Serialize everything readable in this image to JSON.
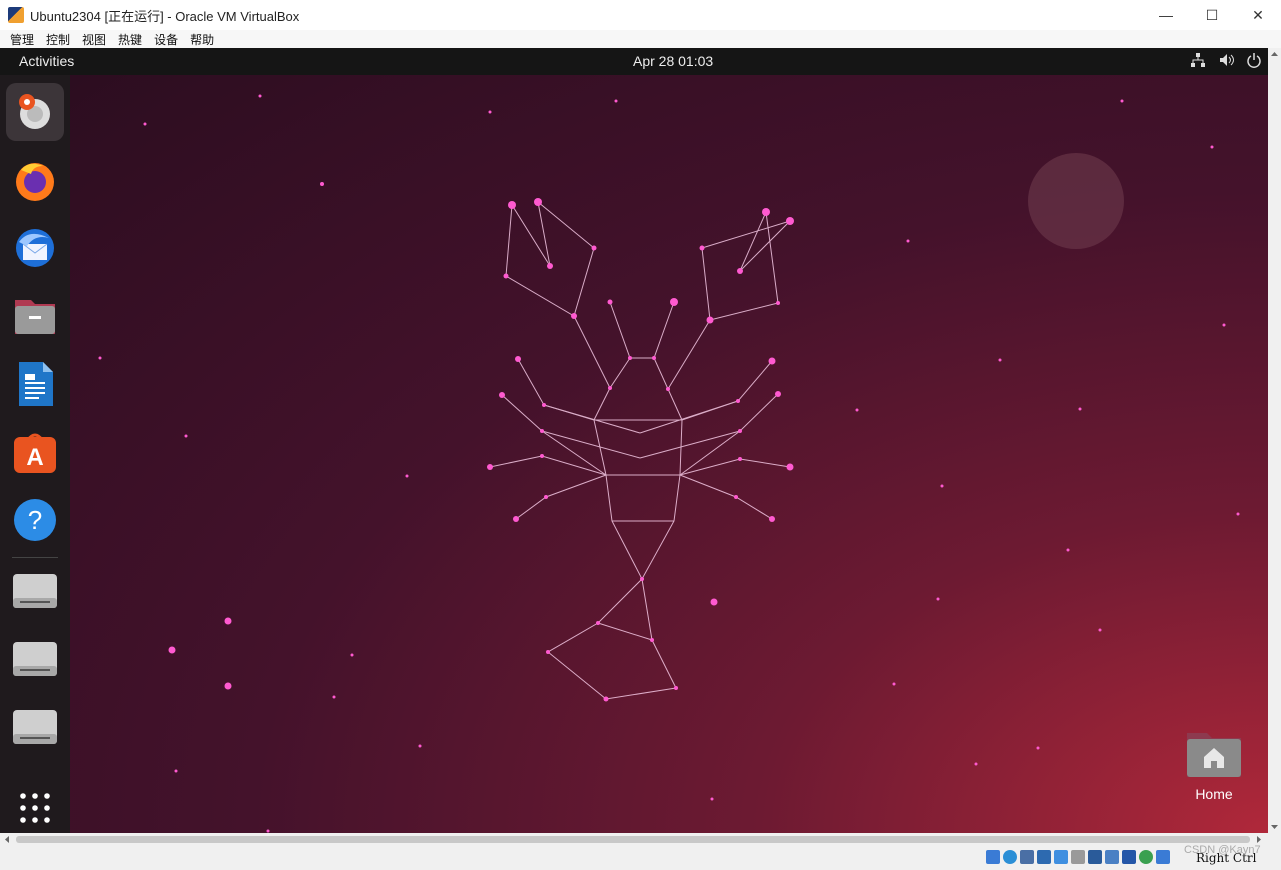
{
  "window": {
    "title": "Ubuntu2304 [正在运行] - Oracle VM VirtualBox",
    "controls": {
      "minimize": "—",
      "maximize": "☐",
      "close": "✕"
    }
  },
  "menubar": [
    "管理",
    "控制",
    "视图",
    "热键",
    "设备",
    "帮助"
  ],
  "guest": {
    "topbar": {
      "activities": "Activities",
      "clock": "Apr 28  01:03",
      "tray_icons": [
        "network-icon",
        "volume-icon",
        "power-icon"
      ]
    },
    "dock": [
      {
        "name": "installer-icon",
        "active": true
      },
      {
        "name": "firefox-icon"
      },
      {
        "name": "thunderbird-icon"
      },
      {
        "name": "files-icon"
      },
      {
        "name": "writer-icon"
      },
      {
        "name": "app-center-icon"
      },
      {
        "name": "help-icon"
      },
      {
        "name": "drive-icon"
      },
      {
        "name": "drive-icon"
      },
      {
        "name": "drive-icon"
      },
      {
        "name": "show-apps-icon"
      }
    ],
    "desktop": {
      "home_label": "Home"
    }
  },
  "statusbar": {
    "hostkey": "Right Ctrl",
    "watermark": "CSDN @Kayn7"
  },
  "colors": {
    "accent": "#e95420",
    "pink_star": "#ff5ad0"
  }
}
